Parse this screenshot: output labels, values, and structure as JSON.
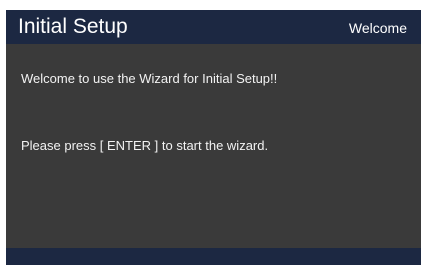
{
  "header": {
    "title": "Initial Setup",
    "page_label": "Welcome"
  },
  "content": {
    "paragraphs": [
      "Welcome to use the Wizard for Initial Setup!!",
      "Please press [ ENTER ] to start the wizard."
    ]
  },
  "colors": {
    "header_background": "#1c2842",
    "content_background": "#3a3a3a",
    "text": "#f2f2f2"
  }
}
